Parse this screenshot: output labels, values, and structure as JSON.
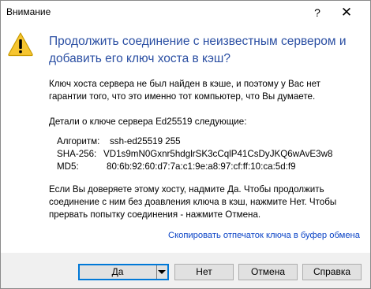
{
  "window": {
    "title": "Внимание",
    "help_glyph": "?",
    "close_glyph": "✕"
  },
  "icon": {
    "name": "warning-icon",
    "colors": {
      "fill": "#f6c530",
      "stroke": "#c99a00",
      "mark": "#000000"
    }
  },
  "message": {
    "headline_line1": "Продолжить соединение с неизвестным сервером и",
    "headline_line2": "добавить его ключ хоста в кэш?",
    "para1_line1": "Ключ хоста сервера не был найден в кэше, и поэтому у Вас нет",
    "para1_line2": "гарантии того, что это именно тот компьютер, что Вы думаете.",
    "para2": "Детали о ключе сервера Ed25519 следующие:",
    "para3_line1": "Если Вы доверяете этому хосту, надмите Да. Чтобы продолжить",
    "para3_line2": "соединение с ним без доавления ключа в кэш, нажмите Нет. Чтобы",
    "para3_line3": "прервать попытку соединения - нажмите Отмена."
  },
  "details": [
    {
      "label": "Алгоритм:",
      "value": "ssh-ed25519 255"
    },
    {
      "label": "SHA-256:",
      "value": "VD1s9mN0Gxnr5hdglrSK3cCqlP41CsDyJKQ6wAvE3w8"
    },
    {
      "label": "MD5:",
      "value": "80:6b:92:60:d7:7a:c1:9e:a8:97:cf:ff:10:ca:5d:f9"
    }
  ],
  "copy_link": "Скопировать отпечаток ключа в буфер обмена",
  "buttons": {
    "yes": "Да",
    "no": "Нет",
    "cancel": "Отмена",
    "help": "Справка"
  },
  "colors": {
    "headline": "#2b4fa3",
    "link": "#0a43c6",
    "default_button_border": "#0078d7",
    "footer_bg": "#f0f0f0"
  }
}
